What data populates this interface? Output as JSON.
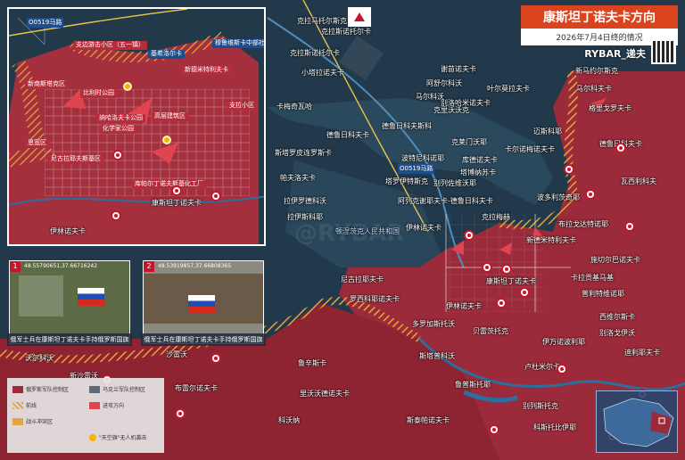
{
  "header": {
    "title": "康斯坦丁诺夫卡方向",
    "date": "2026年7月4日终的情况",
    "brand": "RYBAR_递夫"
  },
  "colors": {
    "russian_control": "#9b2b3a",
    "advance": "#e04451",
    "contested_hatch": "#e7a33c",
    "water": "#2a6fa0",
    "accent": "#d9441f"
  },
  "map_labels": [
    {
      "text": "克拉马托尔斯克",
      "kind": "place"
    },
    {
      "text": "克拉斯诺托尔卡",
      "kind": "place"
    },
    {
      "text": "小塔拉诺夫卡",
      "kind": "place"
    },
    {
      "text": "克拉斯诺托尔卡",
      "kind": "place"
    },
    {
      "text": "谢苗诺夫卡",
      "kind": "place"
    },
    {
      "text": "新马约尔斯克",
      "kind": "place"
    },
    {
      "text": "阿舒尔科沃",
      "kind": "place"
    },
    {
      "text": "叶尔莫拉夫卡",
      "kind": "place"
    },
    {
      "text": "马尔科夫卡",
      "kind": "place"
    },
    {
      "text": "马尔科沃",
      "kind": "place"
    },
    {
      "text": "克里沃沃克",
      "kind": "place"
    },
    {
      "text": "卡梅奇瓦哈",
      "kind": "place"
    },
    {
      "text": "别洛哈米诺夫卡",
      "kind": "place"
    },
    {
      "text": "格里戈罗夫卡",
      "kind": "place"
    },
    {
      "text": "德鲁日科夫卡",
      "kind": "place"
    },
    {
      "text": "德鲁日科夫斯科",
      "kind": "place"
    },
    {
      "text": "克莱门沃耶",
      "kind": "place"
    },
    {
      "text": "卡尔诺梅诺夫卡",
      "kind": "place"
    },
    {
      "text": "迈斯科耶",
      "kind": "place"
    },
    {
      "text": "斯塔罗皮连罗斯卡",
      "kind": "place"
    },
    {
      "text": "德鲁日科夫卡",
      "kind": "place"
    },
    {
      "text": "波特尼科诺耶",
      "kind": "place"
    },
    {
      "text": "库德诺夫卡",
      "kind": "place"
    },
    {
      "text": "塔博纳苏卡",
      "kind": "place"
    },
    {
      "text": "帕夫洛夫卡",
      "kind": "place"
    },
    {
      "text": "塔罗伊特斯克",
      "kind": "place"
    },
    {
      "text": "别列佐维沃耶",
      "kind": "place"
    },
    {
      "text": "阿列克谢耶夫卡-德鲁日科夫卡",
      "kind": "place"
    },
    {
      "text": "波多利茨奇耶",
      "kind": "place"
    },
    {
      "text": "拉伊罗德科沃",
      "kind": "place"
    },
    {
      "text": "瓦西利科夫",
      "kind": "place"
    },
    {
      "text": "拉伊斯科耶",
      "kind": "place"
    },
    {
      "text": "康斯坦丁诺夫卡",
      "kind": "place"
    },
    {
      "text": "克拉梅赫",
      "kind": "place"
    },
    {
      "text": "布拉戈达特诺耶",
      "kind": "place"
    },
    {
      "text": "新德米特利夫卡",
      "kind": "place"
    },
    {
      "text": "伊林诺夫卡",
      "kind": "place"
    },
    {
      "text": "施切尔巴诺夫卡",
      "kind": "place"
    },
    {
      "text": "罗西科耶诺夫卡",
      "kind": "place"
    },
    {
      "text": "伊林诺夫卡",
      "kind": "place"
    },
    {
      "text": "多罗加斯托沃",
      "kind": "place"
    },
    {
      "text": "贝雷茨托克",
      "kind": "place"
    },
    {
      "text": "卡拉贡基马基",
      "kind": "place"
    },
    {
      "text": "西维尔斯卡",
      "kind": "place"
    },
    {
      "text": "尼古拉耶夫卡",
      "kind": "place"
    },
    {
      "text": "普利特维诺耶",
      "kind": "place"
    },
    {
      "text": "伊万诺波利耶",
      "kind": "place"
    },
    {
      "text": "别洛戈伊沃",
      "kind": "place"
    },
    {
      "text": "沃尔科沃",
      "kind": "place"
    },
    {
      "text": "迪利耶夫卡",
      "kind": "place"
    },
    {
      "text": "新沙雷沃",
      "kind": "place"
    },
    {
      "text": "沙雷沃",
      "kind": "place"
    },
    {
      "text": "斯塔普科沃",
      "kind": "place"
    },
    {
      "text": "鲁辛斯卡",
      "kind": "place"
    },
    {
      "text": "卢杜米尔卡",
      "kind": "place"
    },
    {
      "text": "布雷尔诺夫卡",
      "kind": "place"
    },
    {
      "text": "里沃沃德诺夫卡",
      "kind": "place"
    },
    {
      "text": "鲁普斯托耶",
      "kind": "place"
    },
    {
      "text": "科沃纳",
      "kind": "place"
    },
    {
      "text": "别列斯托克",
      "kind": "place"
    },
    {
      "text": "斯泰帕诺夫卡",
      "kind": "place"
    },
    {
      "text": "科斯托比伊耶",
      "kind": "place"
    },
    {
      "text": "顿涅茨克人民共和国",
      "kind": "region"
    }
  ],
  "roads": [
    "O0519马路",
    "O0519马路"
  ],
  "inset": {
    "road": "O0519马路",
    "labels": [
      "支边游击小区（五一镇）",
      "基希洛尔卡",
      "新德米特利夫卡",
      "新南斯塔克区",
      "比利时公园",
      "纳哈洛夫卡公园",
      "化学家公园",
      "高层建筑区",
      "支拉小区",
      "尼古拉耶夫斯基区",
      "库帕尔丁诺夫斯基化工厂",
      "康斯坦丁诺夫卡",
      "伊林诺夫卡",
      "恩宽区",
      "穆鲁维斯卡中部社区"
    ]
  },
  "photos": [
    {
      "num": "1",
      "coords": "48.55790651,37.66716242",
      "caption": "俄军士兵在康斯坦丁诺夫卡手持俄罗斯国旗"
    },
    {
      "num": "2",
      "coords": "48.53919857,37.66808365",
      "caption": "俄军士兵在康斯坦丁诺夫卡手持俄罗斯国旗"
    }
  ],
  "legend": [
    {
      "label": "俄罗斯军队控制区",
      "swatch": "#9b2b3a"
    },
    {
      "label": "乌克兰军队控制区",
      "swatch": "#5b6c78"
    },
    {
      "label": "前线",
      "swatch": "#e7a33c"
    },
    {
      "label": "进攻方向",
      "swatch": "#e04451"
    },
    {
      "label": "战斗冲突区",
      "swatch": "#e7a33c"
    },
    {
      "label": "\"天空旗\"无人机袭击",
      "swatch": "#f5b400"
    }
  ]
}
